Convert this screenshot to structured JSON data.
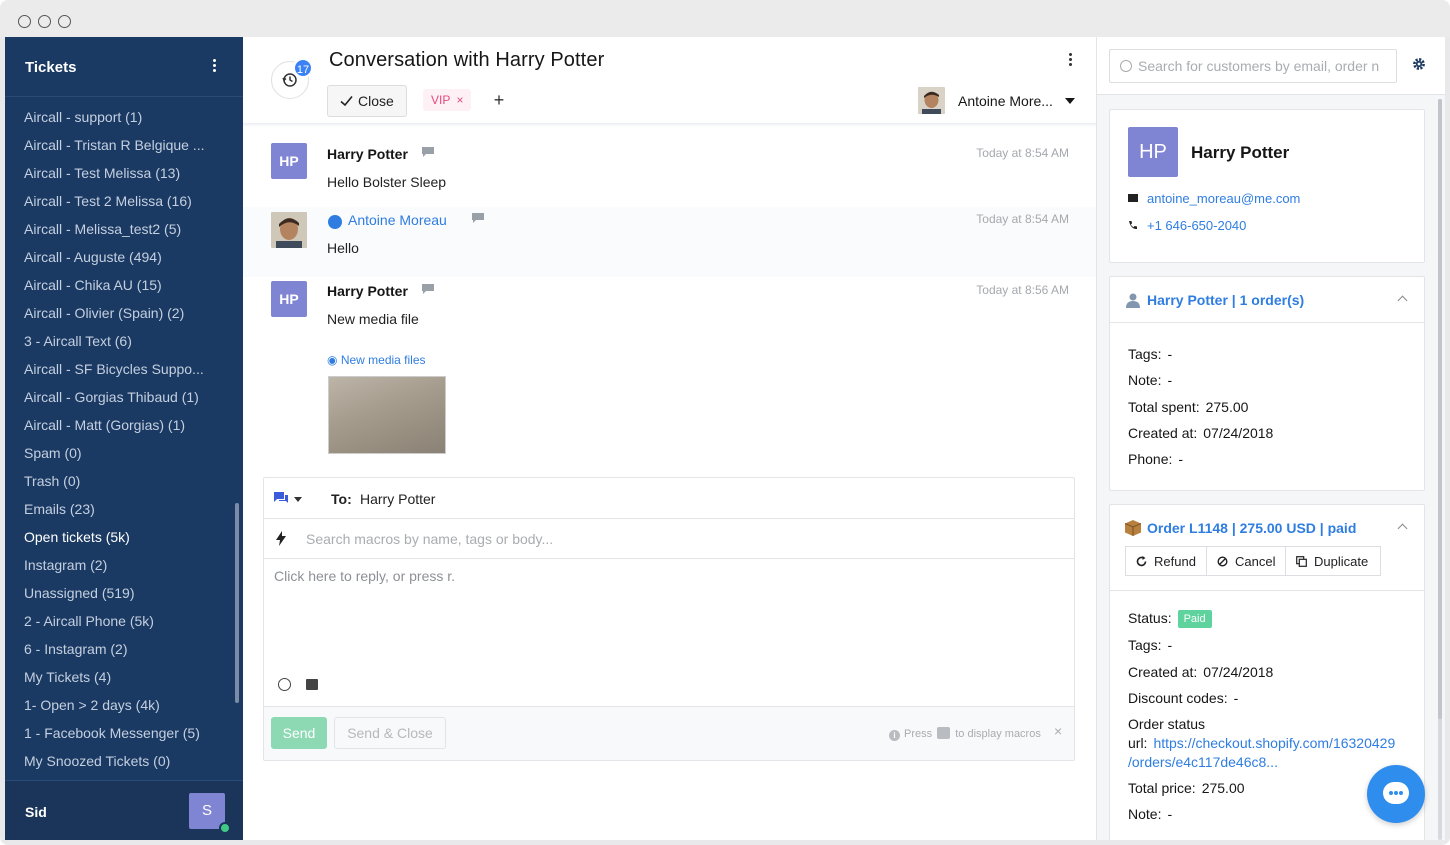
{
  "sidebar": {
    "title": "Tickets",
    "items": [
      {
        "label": "Aircall - support (1)",
        "active": false
      },
      {
        "label": "Aircall - Tristan R Belgique ...",
        "active": false
      },
      {
        "label": "Aircall - Test Melissa (13)",
        "active": false
      },
      {
        "label": "Aircall - Test 2 Melissa (16)",
        "active": false
      },
      {
        "label": "Aircall - Melissa_test2 (5)",
        "active": false
      },
      {
        "label": "Aircall - Auguste (494)",
        "active": false
      },
      {
        "label": "Aircall - Chika AU (15)",
        "active": false
      },
      {
        "label": "Aircall - Olivier (Spain) (2)",
        "active": false
      },
      {
        "label": "3 - Aircall Text (6)",
        "active": false
      },
      {
        "label": "Aircall - SF Bicycles Suppo...",
        "active": false
      },
      {
        "label": "Aircall - Gorgias Thibaud (1)",
        "active": false
      },
      {
        "label": "Aircall - Matt (Gorgias) (1)",
        "active": false
      },
      {
        "label": "Spam (0)",
        "active": false
      },
      {
        "label": "Trash (0)",
        "active": false
      },
      {
        "label": "Emails (23)",
        "active": false
      },
      {
        "label": "Open tickets (5k)",
        "active": true
      },
      {
        "label": "Instagram (2)",
        "active": false
      },
      {
        "label": "Unassigned (519)",
        "active": false
      },
      {
        "label": "2 - Aircall Phone (5k)",
        "active": false
      },
      {
        "label": "6 - Instagram (2)",
        "active": false
      },
      {
        "label": "My Tickets (4)",
        "active": false
      },
      {
        "label": "1- Open > 2 days (4k)",
        "active": false
      },
      {
        "label": "1 - Facebook Messenger (5)",
        "active": false
      },
      {
        "label": "My Snoozed Tickets (0)",
        "active": false
      }
    ],
    "user": {
      "name": "Sid",
      "avatar_initial": "S",
      "status_color": "#40c986"
    }
  },
  "conversation": {
    "history_count": "17",
    "title": "Conversation with Harry Potter",
    "close_label": "Close",
    "tags": [
      "VIP"
    ],
    "tag_remove_glyph": "×",
    "add_tag_glyph": "+",
    "assignee": "Antoine More...",
    "messages": [
      {
        "author": "Harry Potter",
        "avatar": "HP",
        "time": "Today at 8:54 AM",
        "body": "Hello Bolster Sleep",
        "from_agent": false
      },
      {
        "author": "Antoine Moreau",
        "avatar": "photo",
        "time": "Today at 8:54 AM",
        "body": "Hello",
        "from_agent": true
      },
      {
        "author": "Harry Potter",
        "avatar": "HP",
        "time": "Today at 8:56 AM",
        "body": "New media file",
        "from_agent": false
      }
    ],
    "media_link": "New media files"
  },
  "composer": {
    "to_label": "To:",
    "to_value": "Harry Potter",
    "macro_placeholder": "Search macros by name, tags or body...",
    "reply_placeholder": "Click here to reply, or press r.",
    "send_label": "Send",
    "send_close_label": "Send & Close",
    "hint_prefix": "Press",
    "hint_suffix": "to display macros",
    "hint_close": "×"
  },
  "customer_panel": {
    "search_placeholder": "Search for customers by email, order n",
    "customer": {
      "initials": "HP",
      "name": "Harry Potter",
      "email": "antoine_moreau@me.com",
      "phone": "+1 646-650-2040"
    },
    "shopify_customer": {
      "title": "Harry Potter | 1 order(s)",
      "fields": [
        {
          "label": "Tags:",
          "value": "-"
        },
        {
          "label": "Note:",
          "value": "-"
        },
        {
          "label": "Total spent:",
          "value": "275.00"
        },
        {
          "label": "Created at:",
          "value": "07/24/2018"
        },
        {
          "label": "Phone:",
          "value": "-"
        }
      ]
    },
    "order": {
      "title": "Order L1148 | 275.00 USD | paid",
      "actions": [
        "Refund",
        "Cancel",
        "Duplicate"
      ],
      "status_label": "Status:",
      "status_value": "Paid",
      "tags_label": "Tags:",
      "tags_value": "-",
      "created_label": "Created at:",
      "created_value": "07/24/2018",
      "discount_label": "Discount codes:",
      "discount_value": "-",
      "status_url_label_line1": "Order status",
      "status_url_label_line2": "url:",
      "status_url_line1": "https://checkout.shopify.com/16320429",
      "status_url_line2": "/orders/e4c117de46c8...",
      "total_label": "Total price:",
      "total_value": "275.00",
      "note_label": "Note:",
      "note_value": "-"
    }
  },
  "colors": {
    "sidebar_bg": "#1b3a63",
    "accent": "#2f7de1",
    "avatar": "#7f84d3",
    "vip": "#e64980",
    "paid": "#5fd39d",
    "send": "#8cd9b4"
  }
}
